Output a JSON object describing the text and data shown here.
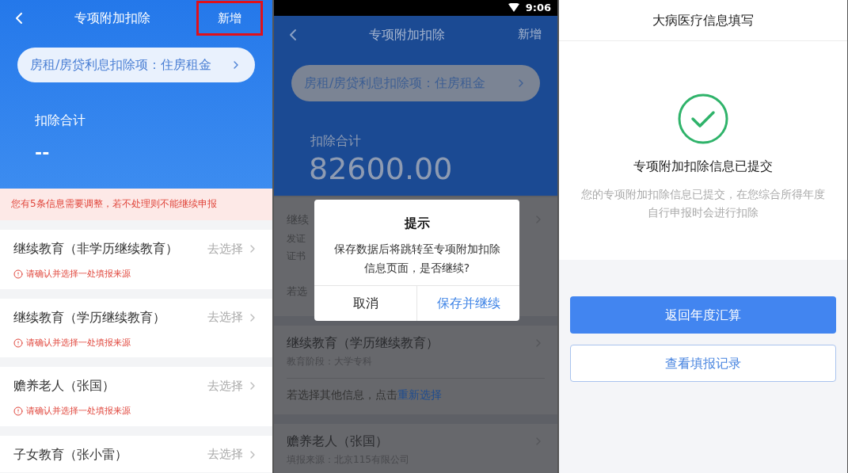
{
  "screens": [
    {
      "kind": "deduction_list",
      "nav": {
        "title": "专项附加扣除",
        "action": "新增",
        "action_highlighted": true
      },
      "summary_pill": "房租/房贷利息扣除项：住房租金",
      "total_label": "扣除合计",
      "total_value": "--",
      "alert": "您有5条信息需要调整，若不处理则不能继续申报",
      "items": [
        {
          "title": "继续教育（非学历继续教育）",
          "action": "去选择",
          "warning": "请确认并选择一处填报来源"
        },
        {
          "title": "继续教育（学历继续教育）",
          "action": "去选择",
          "warning": "请确认并选择一处填报来源"
        },
        {
          "title": "赡养老人（张国）",
          "action": "去选择",
          "warning": "请确认并选择一处填报来源"
        },
        {
          "title": "子女教育（张小雷）",
          "action": "去选择"
        }
      ]
    },
    {
      "kind": "dialog_over_list",
      "status_bar": {
        "time": "9:06"
      },
      "nav": {
        "title": "专项附加扣除",
        "action": "新增",
        "action_highlighted": false
      },
      "summary_pill": "房租/房贷利息扣除项：住房租金",
      "total_label": "扣除合计",
      "total_value": "82600.00",
      "covered_card": {
        "lines": [
          "继续",
          "发证",
          "证书"
        ],
        "footer": "若选"
      },
      "cards": [
        {
          "title": "继续教育（学历继续教育）",
          "subtitle": "教育阶段：大学专科",
          "reselect_prompt": "若选择其他信息，点击",
          "reselect_link": "重新选择"
        },
        {
          "title": "赡养老人（张国）",
          "subtitle": "填报来源：北京115有限公司"
        }
      ],
      "dialog": {
        "title": "提示",
        "message": "保存数据后将跳转至专项附加扣除信息页面，是否继续?",
        "buttons": [
          {
            "label": "取消",
            "primary": false
          },
          {
            "label": "保存并继续",
            "primary": true
          }
        ]
      }
    },
    {
      "kind": "success",
      "title": "大病医疗信息填写",
      "heading": "专项附加扣除信息已提交",
      "message": "您的专项附加扣除信息已提交，在您综合所得年度自行申报时会进行扣除",
      "buttons": [
        {
          "label": "返回年度汇算",
          "primary": true
        },
        {
          "label": "查看填报记录",
          "primary": false
        }
      ]
    }
  ]
}
